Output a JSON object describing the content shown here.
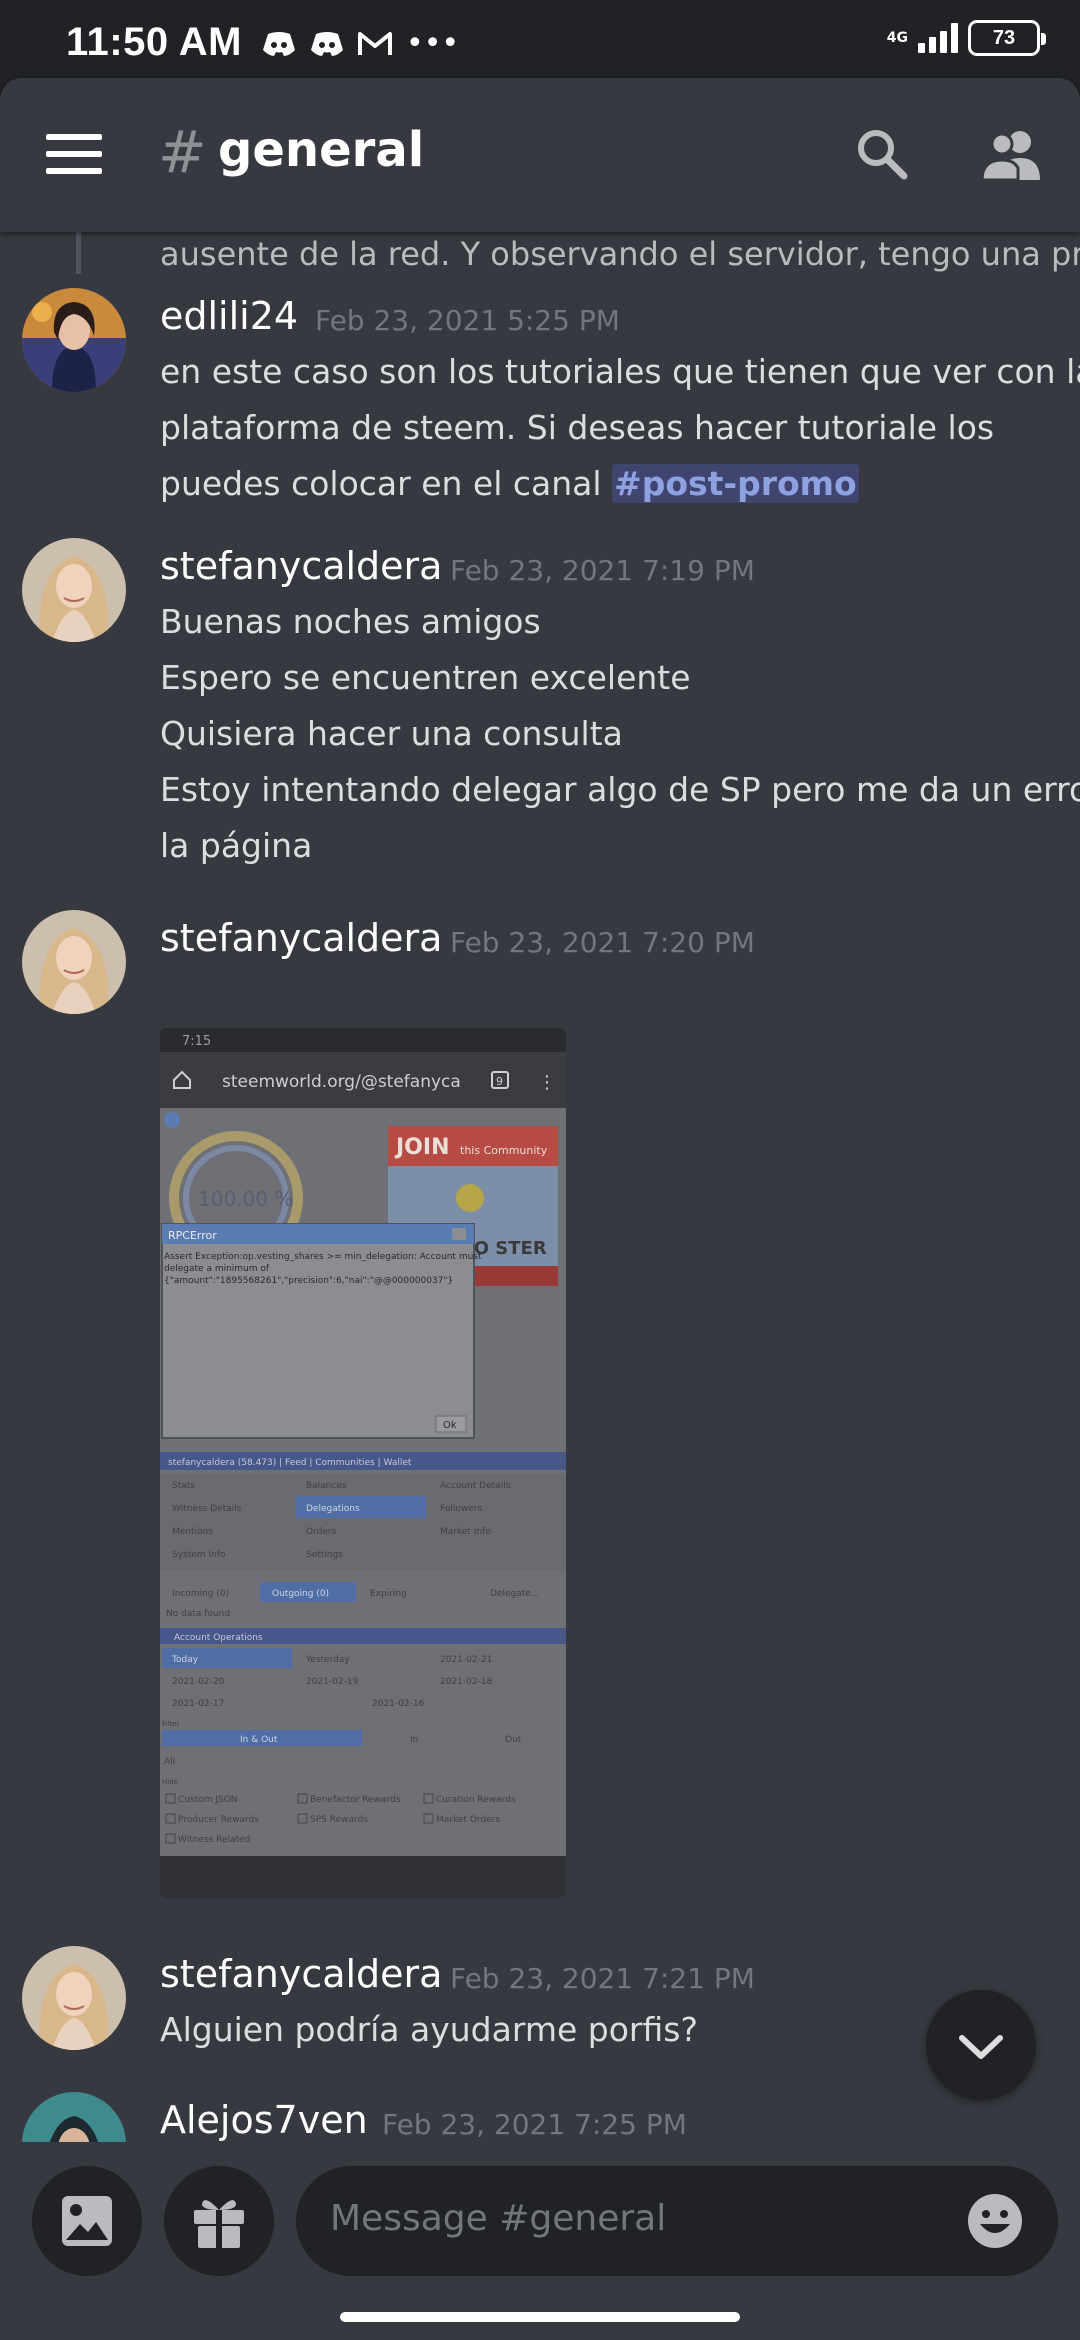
{
  "status_bar": {
    "time": "11:50 AM",
    "notification_icons": [
      "discord-icon",
      "discord-icon",
      "gmail-icon",
      "more-dots-icon"
    ],
    "more_dots": "•••",
    "network": "4G",
    "battery": "73"
  },
  "header": {
    "hash": "#",
    "channel": "general"
  },
  "messages": {
    "continuation": "ausente de la red. Y observando el servidor, tengo una pregunta;",
    "items": [
      {
        "author": "edlili24",
        "timestamp": "Feb 23, 2021 5:25 PM",
        "lines": [
          "en este caso son los tutoriales que tienen que ver con la",
          "plataforma de steem. Si deseas hacer tutoriale los",
          "puedes colocar en el canal "
        ],
        "mention": "#post-promo"
      },
      {
        "author": "stefanycaldera",
        "timestamp": "Feb 23, 2021 7:19 PM",
        "lines": [
          "Buenas noches amigos",
          "Espero se encuentren excelente",
          "Quisiera hacer una consulta",
          "Estoy intentando delegar algo de SP pero me da un error",
          "la página"
        ]
      },
      {
        "author": "stefanycaldera",
        "timestamp": "Feb 23, 2021 7:20 PM",
        "attachment": {
          "phone_time": "7:15",
          "url": "steemworld.org/@stefanyca",
          "tab_count": "9",
          "gauge_value": "100.00 %",
          "banner_join": "JOIN",
          "banner_rest": "this Community",
          "banner_booster": "BO  STER",
          "dialog_title": "RPCError",
          "dialog_text_1": "Assert Exception:op.vesting_shares >= min_delegation: Account must",
          "dialog_text_2": "delegate a minimum of",
          "dialog_text_3": "{\"amount\":\"1895568261\",\"precision\":6,\"nai\":\"@@000000037\"}",
          "dialog_ok": "Ok",
          "nav_text": "stefanycaldera (58.473)  |  Feed  |  Communities  |  Wallet",
          "menu": [
            [
              "Stats",
              "Balances",
              "Account Details"
            ],
            [
              "Witness Details",
              "Delegations",
              "Followers"
            ],
            [
              "Mentions",
              "Orders",
              "Market Info"
            ],
            [
              "System Info",
              "Settings",
              ""
            ]
          ],
          "tabs": [
            "Incoming (0)",
            "Outgoing (0)",
            "Expiring",
            "Delegate..."
          ],
          "no_data": "No data found",
          "section_title": "Account Operations",
          "dates": [
            [
              "Today",
              "Yesterday",
              "2021-02-21"
            ],
            [
              "2021-02-20",
              "2021-02-19",
              "2021-02-18"
            ],
            [
              "2021-02-17",
              "2021-02-16",
              ""
            ]
          ],
          "filter_label": "Filter",
          "filter_tabs": [
            "In & Out",
            "In",
            "Out"
          ],
          "all_label": "All",
          "hide_label": "Hide",
          "checkboxes": [
            [
              "Custom JSON",
              "Benefactor Rewards",
              "Curation Rewards"
            ],
            [
              "Producer Rewards",
              "SPS Rewards",
              "Market Orders"
            ],
            [
              "Witness Related",
              "",
              ""
            ]
          ]
        }
      },
      {
        "author": "stefanycaldera",
        "timestamp": "Feb 23, 2021 7:21 PM",
        "lines": [
          "Alguien podría ayudarme porfis?"
        ]
      },
      {
        "author": "Alejos7ven",
        "timestamp": "Feb 23, 2021 7:25 PM",
        "lines": []
      }
    ]
  },
  "composer": {
    "placeholder": "Message #general"
  },
  "colors": {
    "background": "#36393f",
    "dark": "#202225",
    "mention": "#8ea1e1",
    "timestamp": "#72767d"
  }
}
